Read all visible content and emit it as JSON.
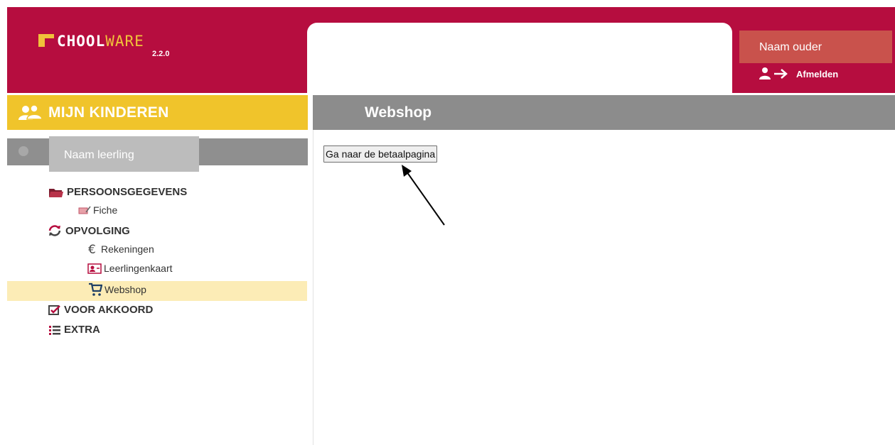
{
  "app": {
    "logo_text_main": "CHOOL",
    "logo_text_accent": "WARE",
    "version": "2.2.0"
  },
  "user": {
    "name": "Naam ouder",
    "logout_label": "Afmelden"
  },
  "sidebar": {
    "header": "MIJN KINDEREN",
    "student_name": "Naam leerling",
    "sections": [
      {
        "label": "PERSOONSGEGEVENS",
        "icon": "folder-icon",
        "items": [
          {
            "label": "Fiche",
            "icon": "id-card-edit-icon"
          }
        ]
      },
      {
        "label": "OPVOLGING",
        "icon": "refresh-icon",
        "items": [
          {
            "label": "Rekeningen",
            "icon": "euro-icon"
          },
          {
            "label": "Leerlingenkaart",
            "icon": "student-card-icon"
          },
          {
            "label": "Webshop",
            "icon": "cart-icon",
            "active": true
          }
        ]
      },
      {
        "label": "VOOR AKKOORD",
        "icon": "checkbox-icon",
        "items": []
      },
      {
        "label": "EXTRA",
        "icon": "list-icon",
        "items": []
      }
    ]
  },
  "main": {
    "title": "Webshop",
    "pay_button_label": "Ga naar de betaalpagina"
  },
  "colors": {
    "brand": "#b60d3f",
    "accent_yellow": "#f0c42b",
    "header_gray": "#8c8c8c",
    "active_row": "#fcecb6",
    "user_box": "#c9524c"
  }
}
